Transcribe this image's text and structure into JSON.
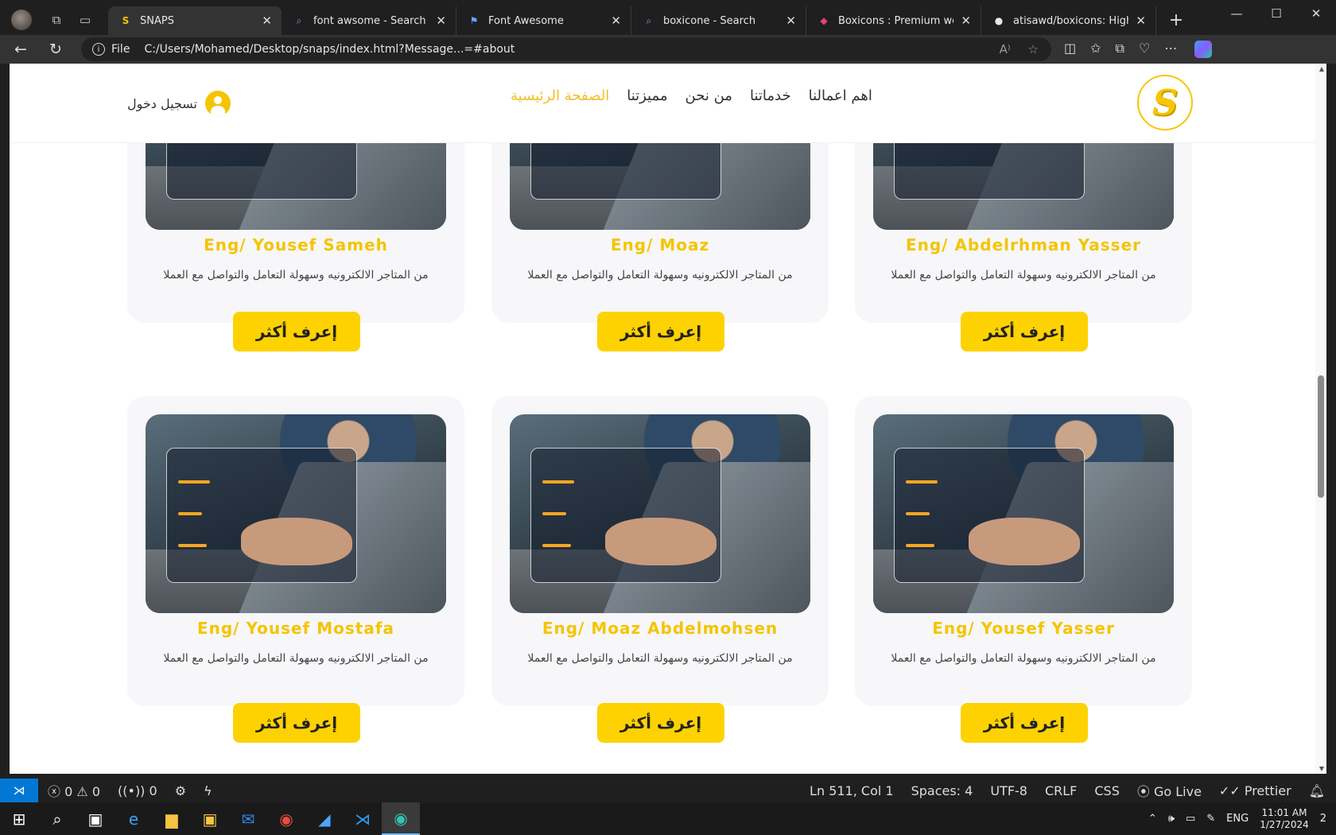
{
  "browser": {
    "tabs": [
      {
        "title": "SNAPS",
        "active": true
      },
      {
        "title": "font awsome - Search"
      },
      {
        "title": "Font Awesome"
      },
      {
        "title": "boxicone - Search"
      },
      {
        "title": "Boxicons : Premium web frien"
      },
      {
        "title": "atisawd/boxicons: High Qual"
      }
    ],
    "address": {
      "scheme_label": "File",
      "url": "C:/Users/Mohamed/Desktop/snaps/index.html?Message...=#about"
    }
  },
  "site": {
    "nav": {
      "links": [
        "الصفحة الرئيسية",
        "مميزتنا",
        "من نحن",
        "خدماتنا",
        "اهم اعمالنا"
      ],
      "active_index": 0,
      "login_label": "تسجيل دخول"
    },
    "cards_top": [
      {
        "name": "Eng/ Abdelrhman Yasser",
        "desc": "من المتاجر الالكترونيه وسهولة التعامل والتواصل مع العملا",
        "button": "إعرف أكثر"
      },
      {
        "name": "Eng/ Moaz",
        "desc": "من المتاجر الالكترونيه وسهولة التعامل والتواصل مع العملا",
        "button": "إعرف أكثر"
      },
      {
        "name": "Eng/ Yousef Sameh",
        "desc": "من المتاجر الالكترونيه وسهولة التعامل والتواصل مع العملا",
        "button": "إعرف أكثر"
      }
    ],
    "cards_bottom": [
      {
        "name": "Eng/ Yousef Yasser",
        "desc": "من المتاجر الالكترونيه وسهولة التعامل والتواصل مع العملا",
        "button": "إعرف أكثر"
      },
      {
        "name": "Eng/ Moaz Abdelmohsen",
        "desc": "من المتاجر الالكترونيه وسهولة التعامل والتواصل مع العملا",
        "button": "إعرف أكثر"
      },
      {
        "name": "Eng/ Yousef Mostafa",
        "desc": "من المتاجر الالكترونيه وسهولة التعامل والتواصل مع العملا",
        "button": "إعرف أكثر"
      }
    ],
    "colors": {
      "accent": "#f5c400",
      "nav_active": "#f0bf2a",
      "button": "#fdd200",
      "card_bg": "#f7f7fa"
    }
  },
  "statusbar": {
    "errors": "0",
    "warnings": "0",
    "ports": "0",
    "position": "Ln 511, Col 1",
    "spaces": "Spaces: 4",
    "encoding": "UTF-8",
    "eol": "CRLF",
    "language": "CSS",
    "go_live": "Go Live",
    "prettier": "Prettier"
  },
  "taskbar": {
    "language": "ENG",
    "time": "11:01 AM",
    "date": "1/27/2024",
    "notifications": "2"
  }
}
